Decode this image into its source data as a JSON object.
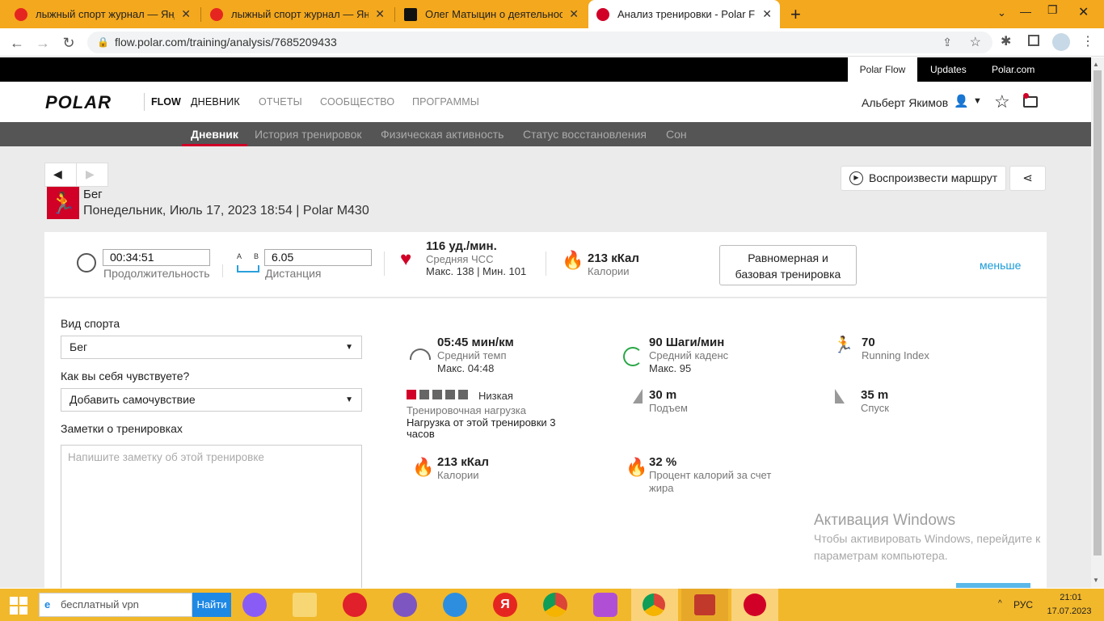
{
  "tabs": [
    {
      "title": "лыжный спорт журнал — Яндекс",
      "favicon": "yandex-icon"
    },
    {
      "title": "лыжный спорт журнал — Яндекс",
      "favicon": "yandex-icon"
    },
    {
      "title": "Олег Матыцин о деятельности",
      "favicon": "s-icon"
    },
    {
      "title": "Анализ тренировки - Polar Flow",
      "favicon": "polar-icon"
    }
  ],
  "url": "flow.polar.com/training/analysis/7685209433",
  "site": {
    "toplinks": [
      "Polar Flow",
      "Updates",
      "Polar.com"
    ],
    "logo": "POLAR",
    "flow": "FLOW",
    "nav": [
      "ДНЕВНИК",
      "ОТЧЕТЫ",
      "СООБЩЕСТВО",
      "ПРОГРАММЫ"
    ],
    "user": "Альберт Якимов",
    "subnav": [
      "Дневник",
      "История тренировок",
      "Физическая активность",
      "Статус восстановления",
      "Сон"
    ]
  },
  "training": {
    "sport_title": "Бег",
    "date_line": "Понедельник, Июль 17, 2023 18:54 | Polar M430",
    "play_route": "Воспроизвести маршрут",
    "duration": "00:34:51",
    "duration_label": "Продолжительность",
    "distance": "6.05",
    "distance_label": "Дистанция",
    "ab_a": "A",
    "ab_b": "B",
    "hr_value": "116 уд./мин.",
    "hr_label": "Средняя ЧСС",
    "hr_minmax": "Макс. 138  |  Мин. 101",
    "cal_value": "213 кКал",
    "cal_label": "Калории",
    "benefit": "Равномерная и базовая тренировка",
    "less": "меньше"
  },
  "form": {
    "sport_label": "Вид спорта",
    "sport_value": "Бег",
    "feel_label": "Как вы себя чувствуете?",
    "feel_value": "Добавить самочувствие",
    "notes_label": "Заметки о тренировках",
    "notes_placeholder": "Напишите заметку об этой тренировке"
  },
  "stats": {
    "pace_value": "05:45 мин/км",
    "pace_label": "Средний темп",
    "pace_max": "Макс. 04:48",
    "cadence_value": "90 Шаги/мин",
    "cadence_label": "Средний каденс",
    "cadence_max": "Макс. 95",
    "ri_value": "70",
    "ri_label": "Running Index",
    "load_level": "Низкая",
    "load_label": "Тренировочная нагрузка",
    "load_desc": "Нагрузка от этой тренировки 3 часов",
    "load_filled": 1,
    "load_total": 5,
    "ascent_value": "30 m",
    "ascent_label": "Подъем",
    "descent_value": "35 m",
    "descent_label": "Спуск",
    "cal_value": "213 кКал",
    "cal_label": "Калории",
    "fat_value": "32 %",
    "fat_label": "Процент калорий за счет жира"
  },
  "watermark": {
    "title": "Активация Windows",
    "line1": "Чтобы активировать Windows, перейдите к",
    "line2": "параметрам компьютера."
  },
  "taskbar": {
    "search_placeholder": "бесплатный vpn",
    "search_btn": "Найти",
    "lang": "РУС",
    "time": "21:01",
    "date": "17.07.2023"
  },
  "colors": {
    "polar_red": "#d10027",
    "taskbar": "#f2b82b",
    "link": "#1a9bd7"
  }
}
